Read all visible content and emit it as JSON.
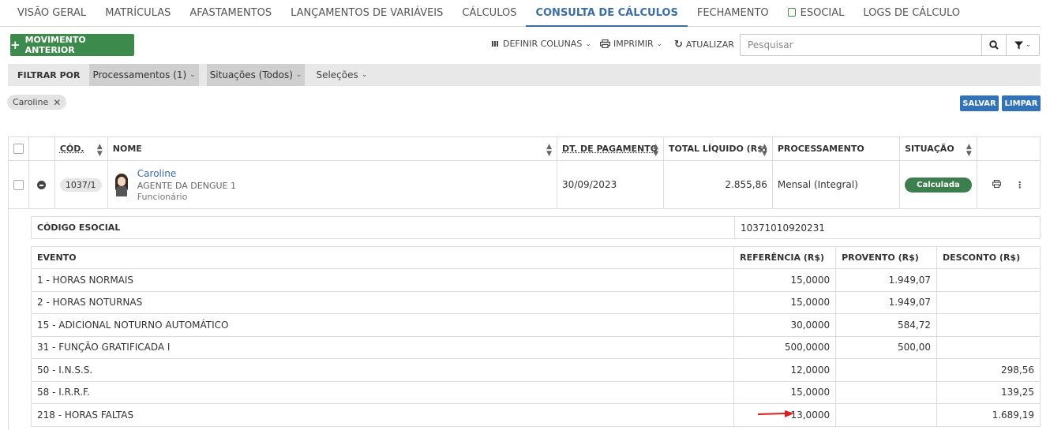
{
  "tabs": [
    {
      "label": "VISÃO GERAL"
    },
    {
      "label": "MATRÍCULAS"
    },
    {
      "label": "AFASTAMENTOS"
    },
    {
      "label": "LANÇAMENTOS DE VARIÁVEIS"
    },
    {
      "label": "CÁLCULOS"
    },
    {
      "label": "CONSULTA DE CÁLCULOS"
    },
    {
      "label": "FECHAMENTO"
    },
    {
      "label": "ESOCIAL"
    },
    {
      "label": "LOGS DE CÁLCULO"
    }
  ],
  "toolbar": {
    "new_button": "MOVIMENTO ANTERIOR",
    "define_columns": "DEFINIR COLUNAS",
    "print": "IMPRIMIR",
    "refresh": "ATUALIZAR",
    "search_placeholder": "Pesquisar"
  },
  "filters": {
    "label": "FILTRAR POR",
    "processing": "Processamentos (1)",
    "situation": "Situações (Todos)",
    "selections": "Seleções",
    "chip": "Caroline",
    "save": "SALVAR",
    "clear": "LIMPAR"
  },
  "table": {
    "headers": {
      "code": "CÓD.",
      "name": "NOME",
      "payment_date": "DT. DE PAGAMENTO",
      "net_total": "TOTAL LÍQUIDO (R$)",
      "processing": "PROCESSAMENTO",
      "status": "SITUAÇÃO"
    },
    "row": {
      "code": "1037/1",
      "name": "Caroline",
      "role": "AGENTE DA DENGUE 1",
      "type": "Funcionário",
      "payment_date": "30/09/2023",
      "net_total": "2.855,86",
      "processing": "Mensal (Integral)",
      "status": "Calculada"
    }
  },
  "detail": {
    "esocial_label": "CÓDIGO ESOCIAL",
    "esocial_value": "10371010920231",
    "headers": {
      "event": "EVENTO",
      "reference": "REFERÊNCIA (R$)",
      "earning": "PROVENTO (R$)",
      "deduction": "DESCONTO (R$)"
    },
    "events": [
      {
        "event": "1 - HORAS NORMAIS",
        "reference": "15,0000",
        "earning": "1.949,07",
        "deduction": ""
      },
      {
        "event": "2 - HORAS NOTURNAS",
        "reference": "15,0000",
        "earning": "1.949,07",
        "deduction": ""
      },
      {
        "event": "15 - ADICIONAL NOTURNO AUTOMÁTICO",
        "reference": "30,0000",
        "earning": "584,72",
        "deduction": ""
      },
      {
        "event": "31 - FUNÇÃO GRATIFICADA I",
        "reference": "500,0000",
        "earning": "500,00",
        "deduction": ""
      },
      {
        "event": "50 - I.N.S.S.",
        "reference": "12,0000",
        "earning": "",
        "deduction": "298,56"
      },
      {
        "event": "58 - I.R.R.F.",
        "reference": "15,0000",
        "earning": "",
        "deduction": "139,25"
      },
      {
        "event": "218 - HORAS FALTAS",
        "reference": "13,0000",
        "earning": "",
        "deduction": "1.689,19"
      }
    ]
  },
  "colors": {
    "accent": "#3b6ea5",
    "green_button": "#3d8b4c",
    "status_badge": "#3d7e4f",
    "blue_button": "#3272b9",
    "annotation_arrow": "#d81e1e"
  }
}
